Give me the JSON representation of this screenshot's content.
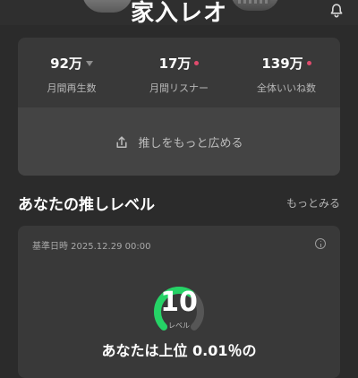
{
  "header": {
    "title": "家入レオ"
  },
  "stats": [
    {
      "value": "92万",
      "label": "月間再生数",
      "marker": "down-triangle-icon"
    },
    {
      "value": "17万",
      "label": "月間リスナー",
      "marker": "dot-icon"
    },
    {
      "value": "139万",
      "label": "全体いいね数",
      "marker": "dot-icon"
    }
  ],
  "share": {
    "label": "推しをもっと広める"
  },
  "section": {
    "title": "あなたの推しレベル",
    "more": "もっとみる"
  },
  "level": {
    "date_label": "基準日時 2025.12.29 00:00",
    "value": "10",
    "unit": "レベル",
    "gauge_fraction": 0.62,
    "rank_text": "あなたは上位 0.01％の"
  },
  "colors": {
    "background": "#2b2b2b",
    "card": "#393939",
    "divider": "#444444",
    "accent": "#25d366",
    "dot": "#e04b6d"
  }
}
